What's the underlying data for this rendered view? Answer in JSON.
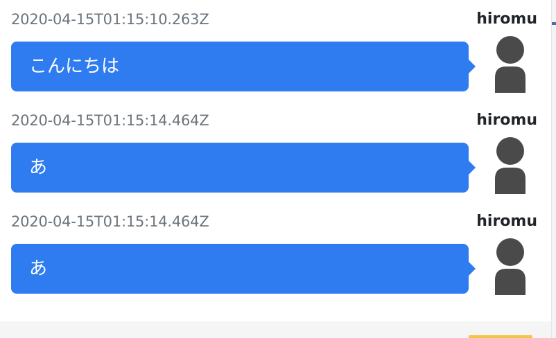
{
  "colors": {
    "bubble": "#2f7bf0",
    "timestamp": "#6c757d",
    "username": "#212529",
    "avatar": "#4a4a4a"
  },
  "messages": [
    {
      "timestamp": "2020-04-15T01:15:10.263Z",
      "user": "hiromu",
      "text": "こんにちは",
      "avatar_icon": "user-avatar-icon"
    },
    {
      "timestamp": "2020-04-15T01:15:14.464Z",
      "user": "hiromu",
      "text": "あ",
      "avatar_icon": "user-avatar-icon"
    },
    {
      "timestamp": "2020-04-15T01:15:14.464Z",
      "user": "hiromu",
      "text": "あ",
      "avatar_icon": "user-avatar-icon"
    }
  ]
}
